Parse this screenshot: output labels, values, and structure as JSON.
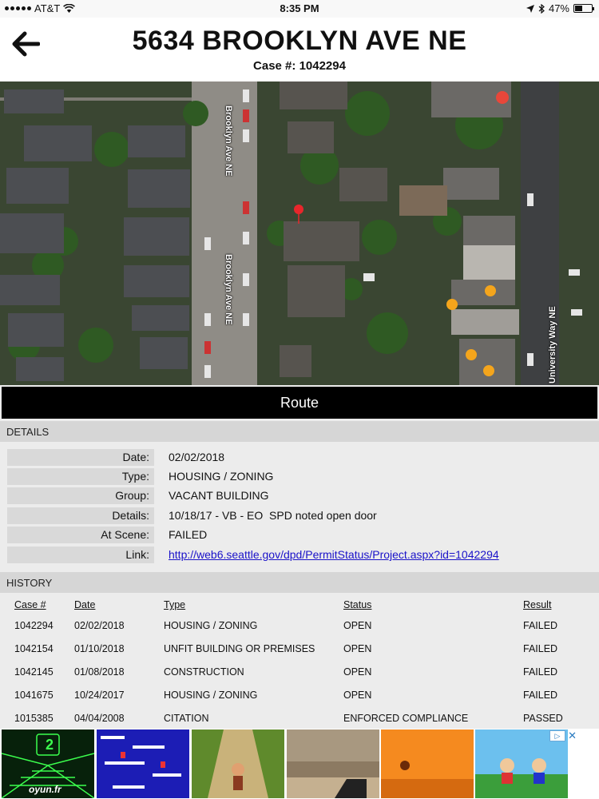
{
  "status_bar": {
    "carrier": "AT&T",
    "time": "8:35 PM",
    "battery": "47%",
    "battery_level": 0.47
  },
  "header": {
    "title": "5634 BROOKLYN AVE NE",
    "subtitle": "Case #: 1042294",
    "back_icon": "arrow-left-icon"
  },
  "map": {
    "street_labels": [
      "Brooklyn Ave NE",
      "Brooklyn Ave NE",
      "University Way NE"
    ],
    "pin_color": "#e8262b"
  },
  "route_label": "Route",
  "details": {
    "section_title": "DETAILS",
    "rows": [
      {
        "label": "Date:",
        "value": "02/02/2018"
      },
      {
        "label": "Type:",
        "value": "HOUSING / ZONING"
      },
      {
        "label": "Group:",
        "value": "VACANT BUILDING"
      },
      {
        "label": "Details:",
        "value": "10/18/17 - VB - EO  SPD noted open door"
      },
      {
        "label": "At Scene:",
        "value": "FAILED"
      },
      {
        "label": "Link:",
        "value": "http://web6.seattle.gov/dpd/PermitStatus/Project.aspx?id=1042294"
      }
    ]
  },
  "history": {
    "section_title": "HISTORY",
    "columns": [
      "Case #",
      "Date",
      "Type",
      "Status",
      "Result"
    ],
    "rows": [
      [
        "1042294",
        "02/02/2018",
        "HOUSING / ZONING",
        "OPEN",
        "FAILED"
      ],
      [
        "1042154",
        "01/10/2018",
        "UNFIT BUILDING OR PREMISES",
        "OPEN",
        "FAILED"
      ],
      [
        "1042145",
        "01/08/2018",
        "CONSTRUCTION",
        "OPEN",
        "FAILED"
      ],
      [
        "1041675",
        "10/24/2017",
        "HOUSING / ZONING",
        "OPEN",
        "FAILED"
      ],
      [
        "1015385",
        "04/04/2008",
        "CITATION",
        "ENFORCED COMPLIANCE",
        "PASSED"
      ]
    ]
  },
  "ad": {
    "first_tile_text": "oyun.fr",
    "first_tile_number": "2",
    "close_symbol": "✕",
    "choices_icon": "adchoices-icon"
  }
}
